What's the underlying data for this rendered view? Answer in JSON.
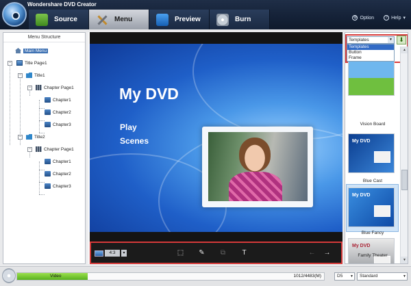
{
  "app": {
    "title": "Wondershare DVD Creator"
  },
  "tabs": [
    {
      "label": "Source",
      "icon": "source-icon"
    },
    {
      "label": "Menu",
      "icon": "menu-icon",
      "active": true
    },
    {
      "label": "Preview",
      "icon": "preview-icon"
    },
    {
      "label": "Burn",
      "icon": "burn-icon"
    }
  ],
  "header_right": {
    "option": "Option",
    "help": "Help"
  },
  "menu_structure": {
    "heading": "Menu Structure",
    "nodes": [
      {
        "label": "Main Menu",
        "selected": true
      },
      {
        "label": "Title Page1"
      },
      {
        "label": "Title1"
      },
      {
        "label": "Chapter Page1"
      },
      {
        "label": "Chapter1"
      },
      {
        "label": "Chapter2"
      },
      {
        "label": "Chapter3"
      },
      {
        "label": "Title2"
      },
      {
        "label": "Chapter Page1"
      },
      {
        "label": "Chapter1"
      },
      {
        "label": "Chapter2"
      },
      {
        "label": "Chapter3"
      }
    ]
  },
  "preview": {
    "title": "My DVD",
    "play": "Play",
    "scenes": "Scenes",
    "aspect_ratio": "4:3"
  },
  "templates": {
    "dropdown_value": "Templates",
    "dropdown_options": [
      "Templates",
      "Button",
      "Frame"
    ],
    "items": [
      {
        "label": "Vision Board"
      },
      {
        "label": "Blue Cast",
        "thumb_title": "My DVD"
      },
      {
        "label": "Blue Fancy",
        "thumb_title": "My DVD",
        "selected": true
      },
      {
        "label": "Family Theater",
        "thumb_title": "My DVD"
      }
    ]
  },
  "status": {
    "disc_label": "Video",
    "size": "1012/4483(M)",
    "disc_type": "D5",
    "quality": "Standard",
    "progress_fraction": 0.23
  },
  "colors": {
    "highlight_outline": "#d63a3a",
    "selection": "#3b6fb2",
    "header": "#152238"
  }
}
